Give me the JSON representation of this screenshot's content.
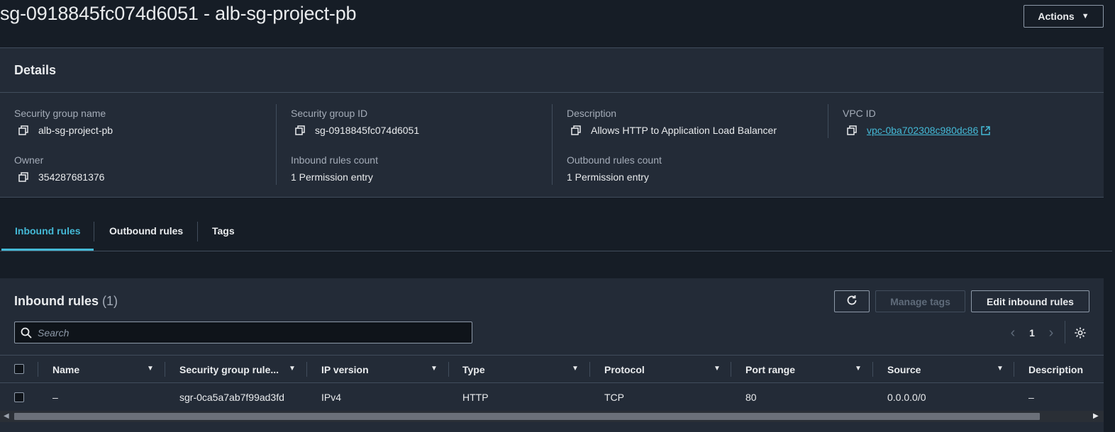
{
  "header": {
    "title": "sg-0918845fc074d6051 - alb-sg-project-pb",
    "actions_label": "Actions",
    "actions_caret": "▼"
  },
  "details": {
    "title": "Details",
    "fields": {
      "sg_name": {
        "label": "Security group name",
        "value": "alb-sg-project-pb"
      },
      "sg_id": {
        "label": "Security group ID",
        "value": "sg-0918845fc074d6051"
      },
      "description": {
        "label": "Description",
        "value": "Allows HTTP to Application Load Balancer"
      },
      "vpc_id": {
        "label": "VPC ID",
        "value": "vpc-0ba702308c980dc86"
      },
      "owner": {
        "label": "Owner",
        "value": "354287681376"
      },
      "inbound_count": {
        "label": "Inbound rules count",
        "value": "1 Permission entry"
      },
      "outbound_count": {
        "label": "Outbound rules count",
        "value": "1 Permission entry"
      }
    }
  },
  "tabs": [
    {
      "label": "Inbound rules",
      "active": true
    },
    {
      "label": "Outbound rules",
      "active": false
    },
    {
      "label": "Tags",
      "active": false
    }
  ],
  "inbound": {
    "title": "Inbound rules",
    "count": "(1)",
    "manage_tags_label": "Manage tags",
    "edit_label": "Edit inbound rules",
    "search_placeholder": "Search",
    "page": "1",
    "prev": "‹",
    "next": "›",
    "columns": [
      "Name",
      "Security group rule...",
      "IP version",
      "Type",
      "Protocol",
      "Port range",
      "Source",
      "Description"
    ],
    "rows": [
      {
        "name": "–",
        "rule_id": "sgr-0ca5a7ab7f99ad3fd",
        "ip_version": "IPv4",
        "type": "HTTP",
        "protocol": "TCP",
        "port_range": "80",
        "source": "0.0.0.0/0",
        "description": "–"
      }
    ]
  },
  "scrollbar": {
    "left_arrow": "◀",
    "right_arrow": "▶"
  },
  "colors": {
    "accent": "#44b9d6",
    "background": "#161d26",
    "panel": "#232b37",
    "border": "#414d5c"
  }
}
